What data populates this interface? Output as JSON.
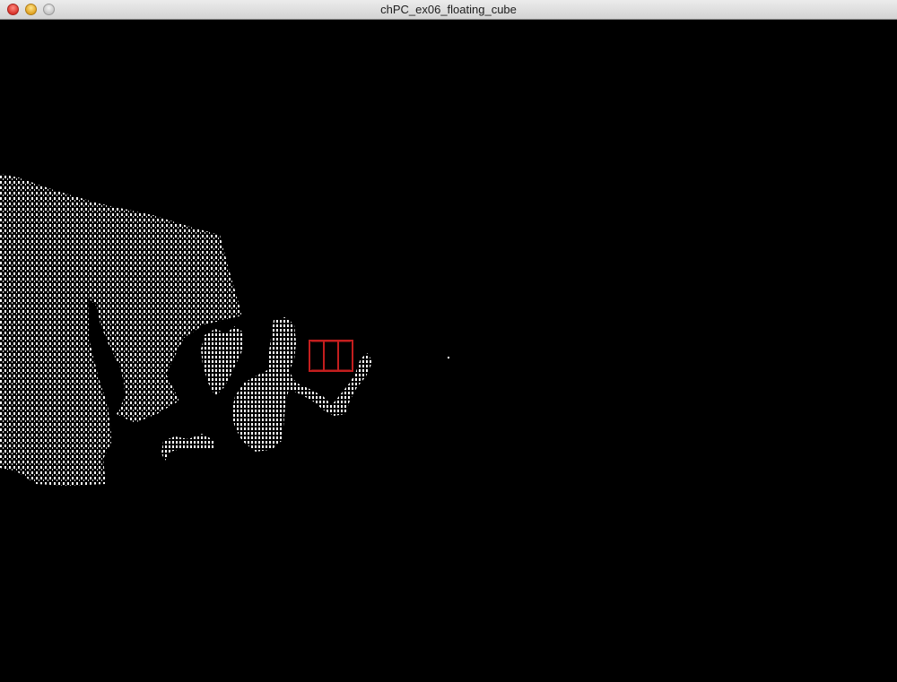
{
  "window": {
    "title": "chPC_ex06_floating_cube"
  },
  "scene": {
    "background_color": "#000000",
    "point_color": "#ffffff",
    "cube_color": "#c41e1e"
  }
}
